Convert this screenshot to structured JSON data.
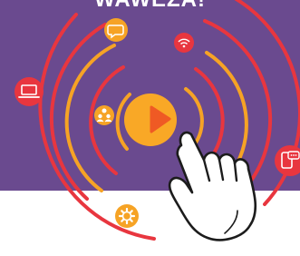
{
  "header": {
    "title": "WAWEZA!"
  },
  "colors": {
    "purple_background": "#6a4a8f",
    "white_floor": "#ffffff",
    "ring_red": "#e8363f",
    "ring_orange": "#f6a325",
    "play_button": "#f9a826",
    "play_triangle": "#ef5a24",
    "hand_outline": "#1c1c1c"
  },
  "icons": [
    "chat-bubble-icon",
    "wifi-icon",
    "laptop-icon",
    "people-icon",
    "play-icon",
    "mobile-chat-icon",
    "gear-icon",
    "pointing-hand-icon"
  ]
}
